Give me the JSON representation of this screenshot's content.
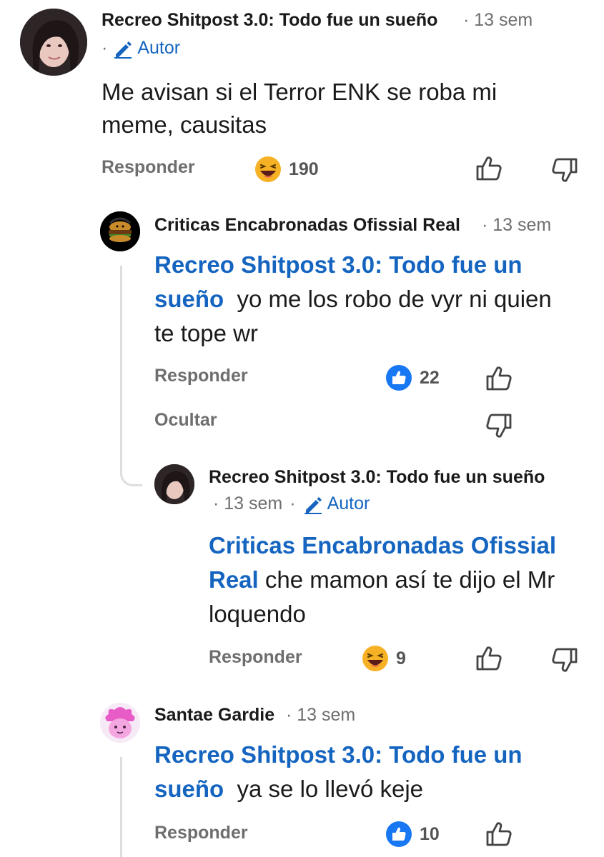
{
  "comments": [
    {
      "author": "Recreo Shitpost 3.0: Todo fue un sueño",
      "time": "· 13 sem",
      "author_badge": "Autor",
      "meta_prefix": "·",
      "text": "Me avisan si el Terror ENK se roba mi meme, causitas",
      "reply_label": "Responder",
      "reaction_count": "190",
      "reaction_icon": "haha-emoji-icon"
    },
    {
      "author": "Criticas Encabronadas Ofissial Real",
      "time": "· 13 sem",
      "mention": "Recreo Shitpost 3.0: Todo fue un sueño",
      "text": "yo me los robo de vyr ni quien te tope wr",
      "reply_label": "Responder",
      "hide_label": "Ocultar",
      "reaction_count": "22",
      "reaction_icon": "like-reaction-icon"
    },
    {
      "author": "Recreo Shitpost 3.0: Todo fue un sueño",
      "time": "· 13 sem",
      "author_badge": "Autor",
      "mention": "Criticas Encabronadas Ofissial Real",
      "text": "che mamon así te dijo el Mr loquendo",
      "reply_label": "Responder",
      "reaction_count": "9",
      "reaction_icon": "haha-emoji-icon"
    },
    {
      "author": "Santae Gardie",
      "time": "· 13 sem",
      "mention": "Recreo Shitpost 3.0: Todo fue un sueño",
      "text": "ya se lo llevó keje",
      "reply_label": "Responder",
      "reaction_count": "10",
      "reaction_icon": "like-reaction-icon"
    }
  ],
  "colors": {
    "link_blue": "#1565c0",
    "meta_gray": "#6e6e6e",
    "like_blue": "#1877f2",
    "haha_yellow": "#f7b125"
  }
}
